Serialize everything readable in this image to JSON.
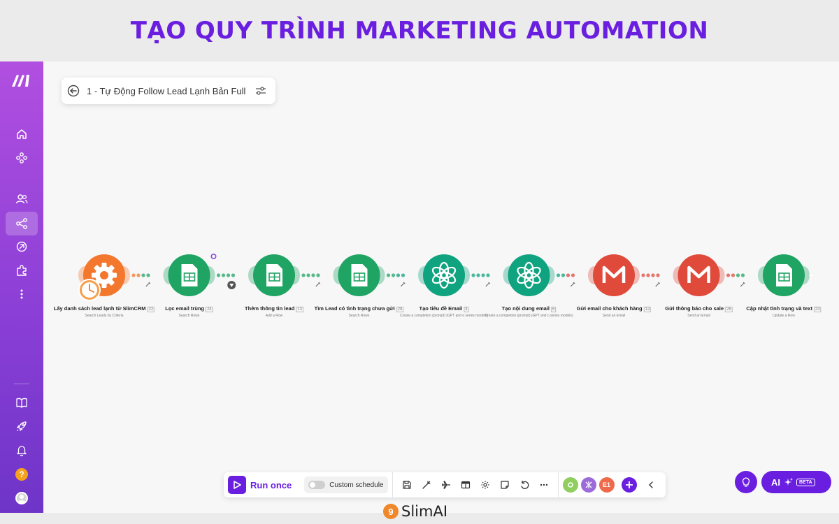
{
  "banner": {
    "title": "TẠO QUY TRÌNH MARKETING AUTOMATION"
  },
  "sidebar": {
    "items": [
      {
        "name": "home-icon"
      },
      {
        "name": "templates-icon"
      },
      {
        "name": "team-icon"
      },
      {
        "name": "share-icon"
      },
      {
        "name": "connections-icon"
      },
      {
        "name": "apps-icon"
      },
      {
        "name": "more-icon"
      },
      {
        "name": "docs-icon"
      },
      {
        "name": "rocket-icon"
      },
      {
        "name": "bell-icon"
      }
    ],
    "help_label": "?"
  },
  "scenario": {
    "title": "1 - Tự Động Follow Lead Lạnh Bản Full"
  },
  "modules": [
    {
      "label": "Lấy danh sách lead lạnh từ SlimCRM",
      "index": "22",
      "sub": "Search Leads by Criteria",
      "app": "slimcrm",
      "color": "#f4772e"
    },
    {
      "label": "Lọc email trùng",
      "index": "24",
      "sub": "Search Rows",
      "app": "google-sheets",
      "color": "#1fa463"
    },
    {
      "label": "Thêm thông tin lead",
      "index": "13",
      "sub": "Add a Row",
      "app": "google-sheets",
      "color": "#1fa463"
    },
    {
      "label": "Tìm Lead có tình trạng chưa gửi",
      "index": "28",
      "sub": "Search Rows",
      "app": "google-sheets",
      "color": "#1fa463"
    },
    {
      "label": "Tạo tiêu đề Email",
      "index": "3",
      "sub": "Create a completion (prompt) (GPT and o series models)",
      "app": "openai",
      "color": "#10a37f"
    },
    {
      "label": "Tạo nội dung email",
      "index": "6",
      "sub": "Create a completion (prompt) (GPT and o series models)",
      "app": "openai",
      "color": "#10a37f"
    },
    {
      "label": "Gửi email cho khách hàng",
      "index": "12",
      "sub": "Send an Email",
      "app": "gmail",
      "color": "#e04a3b"
    },
    {
      "label": "Gửi thông báo cho sale",
      "index": "26",
      "sub": "Send an Email",
      "app": "gmail",
      "color": "#e04a3b"
    },
    {
      "label": "Cập nhật tình trạng và text",
      "index": "23",
      "sub": "Update a Row",
      "app": "google-sheets",
      "color": "#1fa463"
    }
  ],
  "toolbar": {
    "run_label": "Run once",
    "schedule_label": "Custom schedule",
    "apps_badge": "E1"
  },
  "assist": {
    "ai_label": "AI",
    "beta_label": "BETA"
  },
  "brand": {
    "mark": "9",
    "name": "SlimAI"
  }
}
